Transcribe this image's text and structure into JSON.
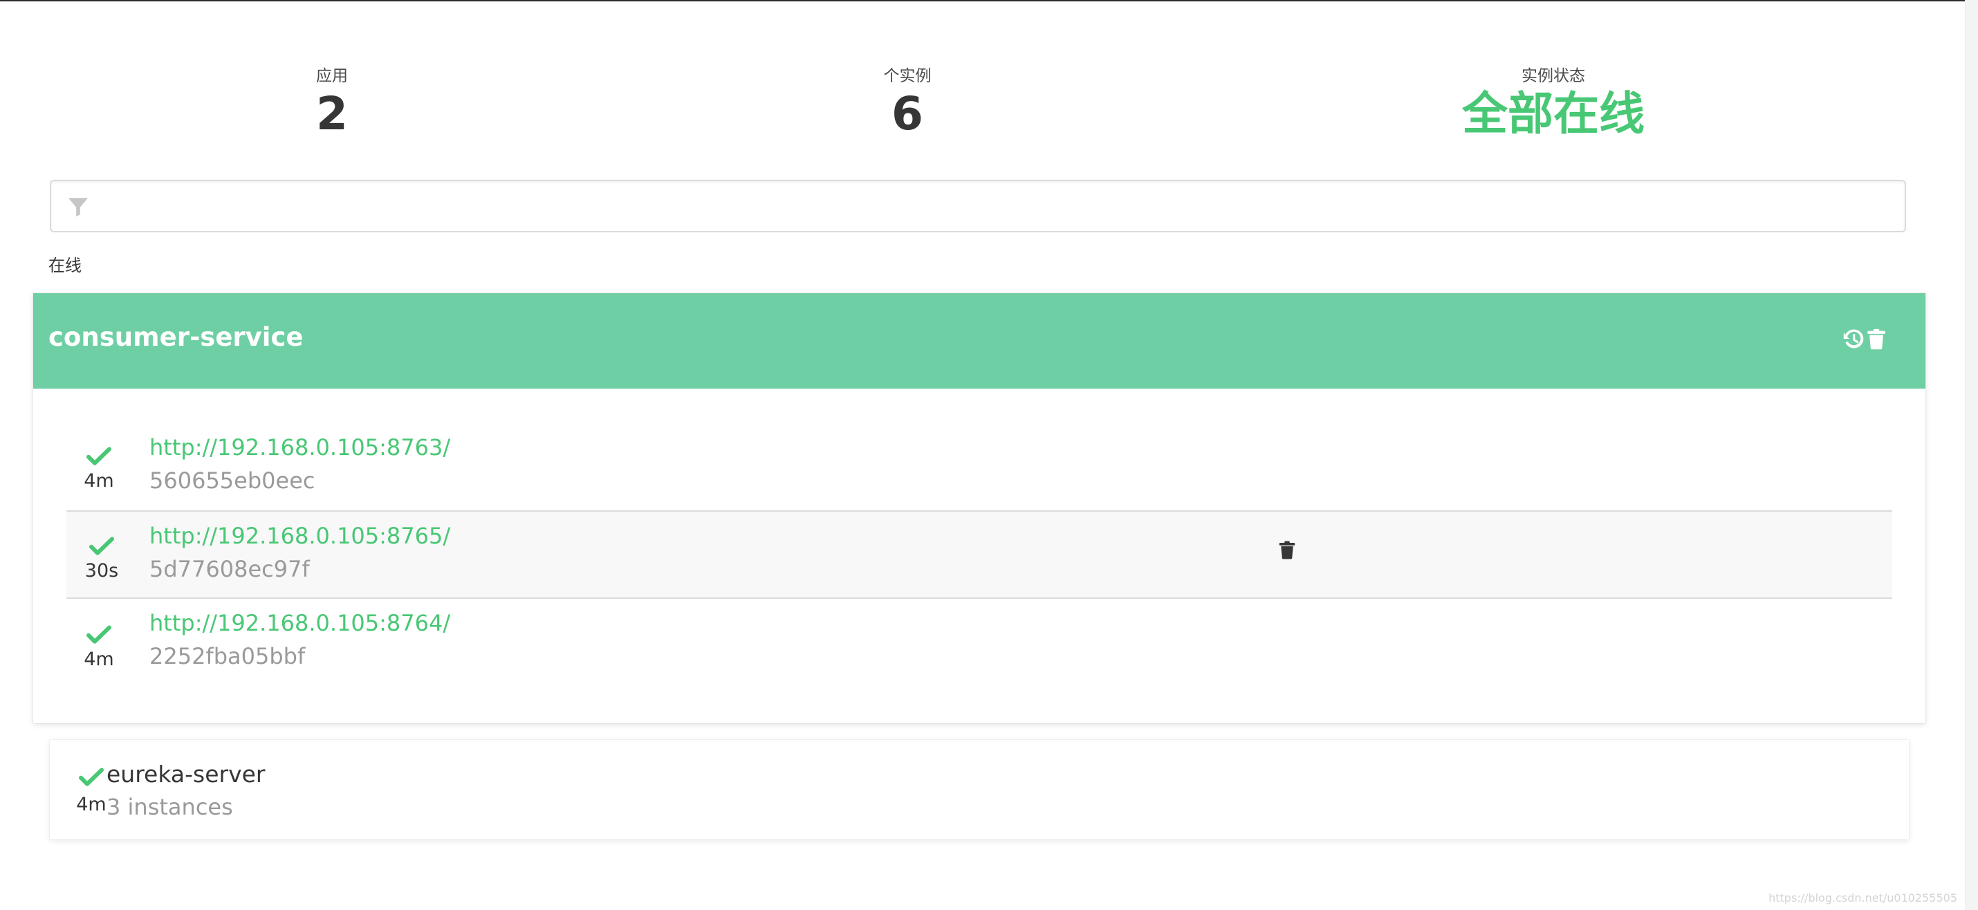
{
  "summary": {
    "apps_label": "应用",
    "apps_value": "2",
    "instances_label": "个实例",
    "instances_value": "6",
    "status_label": "实例状态",
    "status_value": "全部在线"
  },
  "filter": {
    "icon": "filter-icon",
    "value": ""
  },
  "section": {
    "title": "在线"
  },
  "applications": [
    {
      "name": "consumer-service",
      "header_actions": [
        "history-icon",
        "trash-icon"
      ],
      "instances": [
        {
          "url": "http://192.168.0.105:8763/",
          "id": "560655eb0eec",
          "age": "4m",
          "status_icon": "check-icon"
        },
        {
          "url": "http://192.168.0.105:8765/",
          "id": "5d77608ec97f",
          "age": "30s",
          "status_icon": "check-icon",
          "action_icon": "trash-icon"
        },
        {
          "url": "http://192.168.0.105:8764/",
          "id": "2252fba05bbf",
          "age": "4m",
          "status_icon": "check-icon"
        }
      ]
    },
    {
      "name": "eureka-server",
      "subtitle": "3 instances",
      "age": "4m",
      "status_icon": "check-icon"
    }
  ],
  "colors": {
    "accent": "#48c774",
    "header_bg": "#6fcfa4",
    "text": "#363636",
    "muted": "#9a9a9a"
  },
  "watermark": "https://blog.csdn.net/u010255505"
}
